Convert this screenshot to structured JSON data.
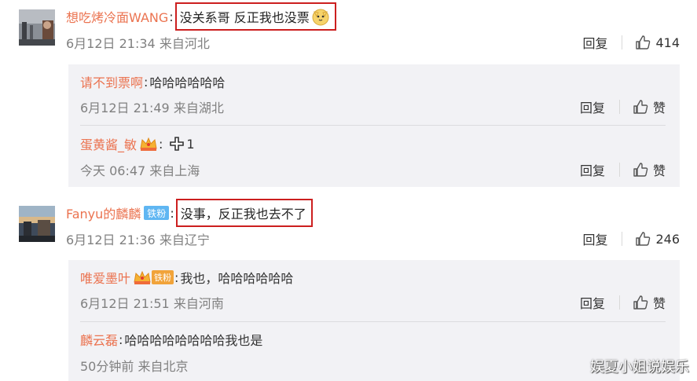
{
  "comments": [
    {
      "username": "想吃烤冷面WANG",
      "text": "没关系哥 反正我也没票",
      "emoji": "cat-emoji",
      "meta": "6月12日 21:34 来自河北",
      "reply": "回复",
      "likes": "414",
      "replies": [
        {
          "username": "请不到票啊",
          "text": "哈哈哈哈哈哈",
          "meta": "6月12日 21:49 来自湖北",
          "reply": "回复",
          "like": "赞"
        },
        {
          "username": "蛋黄酱_敏",
          "text": "1",
          "meta": "今天 06:47 来自上海",
          "reply": "回复",
          "like": "赞"
        }
      ]
    },
    {
      "username": "Fanyu的麟麟",
      "badge": "铁粉",
      "text": "没事，反正我也去不了",
      "meta": "6月12日 21:36 来自辽宁",
      "reply": "回复",
      "likes": "246",
      "replies": [
        {
          "username": "唯爱墨叶",
          "badge": "铁粉",
          "text": "我也，哈哈哈哈哈哈",
          "meta": "6月12日 21:51 来自河南",
          "reply": "回复",
          "like": "赞"
        },
        {
          "username": "麟云磊",
          "text": "哈哈哈哈哈哈哈哈我也是",
          "meta": "50分钟前 来自北京"
        }
      ]
    }
  ],
  "watermark": "娱夏小姐说娱乐",
  "colors": {
    "username": "#eb7350",
    "highlight_border": "#cc1f1f",
    "reply_bg": "#f2f2f5",
    "fan_badge": "#5fb6f2"
  }
}
